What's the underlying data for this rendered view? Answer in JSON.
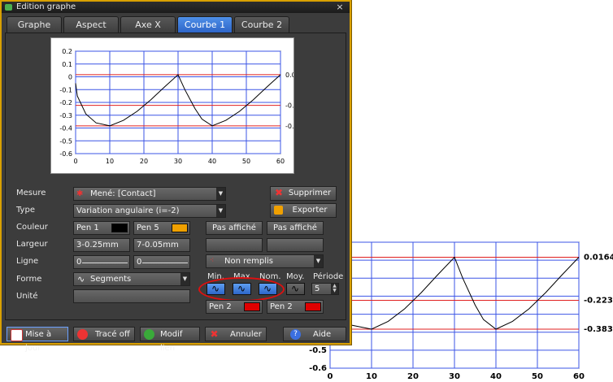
{
  "window": {
    "title": "Edition graphe",
    "close_label": "×"
  },
  "tabs": [
    {
      "label": "Graphe"
    },
    {
      "label": "Aspect"
    },
    {
      "label": "Axe X"
    },
    {
      "label": "Courbe 1",
      "active": true
    },
    {
      "label": "Courbe 2"
    }
  ],
  "chart_data": [
    {
      "type": "line",
      "x": [
        0,
        0.5,
        3,
        6,
        10,
        14,
        18,
        22,
        26,
        30,
        32,
        35,
        37,
        40,
        44,
        48,
        52,
        56,
        60
      ],
      "y": [
        -0.05,
        -0.15,
        -0.29,
        -0.36,
        -0.383,
        -0.34,
        -0.27,
        -0.18,
        -0.08,
        0.0164,
        -0.1,
        -0.25,
        -0.33,
        -0.383,
        -0.34,
        -0.27,
        -0.18,
        -0.08,
        0.0164
      ],
      "xlim": [
        0,
        60
      ],
      "ylim": [
        -0.6,
        0.2
      ],
      "xticks": [
        "0",
        "10",
        "20",
        "30",
        "40",
        "50",
        "60"
      ],
      "yticks": [
        "0.2",
        "0.1",
        "0",
        "-0.1",
        "-0.2",
        "-0.3",
        "-0.4",
        "-0.5",
        "-0.6"
      ],
      "hlines": [
        0.0164,
        -0.223,
        -0.383
      ],
      "hline_labels": [
        "0.0164",
        "-0.223",
        "-0.383"
      ],
      "grid": true,
      "line_color": "#000000",
      "grid_color": "#3b55e6",
      "hline_color": "#e02020"
    },
    {
      "type": "line",
      "x": [
        0,
        2,
        5,
        10,
        14,
        18,
        22,
        26,
        30,
        32,
        35,
        37,
        40,
        44,
        48,
        52,
        56,
        60
      ],
      "y": [
        -0.2,
        -0.3,
        -0.36,
        -0.383,
        -0.34,
        -0.27,
        -0.18,
        -0.08,
        0.0164,
        -0.1,
        -0.25,
        -0.33,
        -0.383,
        -0.34,
        -0.27,
        -0.18,
        -0.08,
        0.0164
      ],
      "xlim": [
        0,
        60
      ],
      "ylim": [
        -0.6,
        0.1
      ],
      "xticks": [
        "0",
        "10",
        "20",
        "30",
        "40",
        "50",
        "60"
      ],
      "yticks": [
        "-0.5",
        "-0.6"
      ],
      "hlines": [
        0.0164,
        -0.223,
        -0.383
      ],
      "hline_labels": [
        "0.0164",
        "-0.223",
        "-0.383"
      ],
      "grid": true,
      "line_color": "#000000",
      "grid_color": "#3b55e6",
      "hline_color": "#e02020"
    }
  ],
  "form": {
    "mesure": {
      "label": "Mesure",
      "value": "Mené: [Contact]"
    },
    "type": {
      "label": "Type",
      "value": "Variation angulaire (i=-2)"
    },
    "couleur": {
      "label": "Couleur",
      "pen1": "Pen 1",
      "pen1_color": "#000000",
      "pen5": "Pen 5",
      "pen5_color": "#f0a000",
      "pas1": "Pas affiché",
      "pas2": "Pas affiché"
    },
    "largeur": {
      "label": "Largeur",
      "v1": "3-0.25mm",
      "v2": "7-0.05mm"
    },
    "ligne": {
      "label": "Ligne",
      "v1": "0",
      "v2": "0",
      "remplis": "Non remplis"
    },
    "forme": {
      "label": "Forme",
      "value": "Segments"
    },
    "unite": {
      "label": "Unité",
      "value": ""
    },
    "stats": {
      "min": "Min.",
      "max": "Max.",
      "nom": "Nom.",
      "moy": "Moy.",
      "periode": "Période",
      "periode_value": "5"
    },
    "pen2a": "Pen 2",
    "pen2b": "Pen 2",
    "pen2_color": "#e00000"
  },
  "side_buttons": {
    "supprimer": "Supprimer",
    "exporter": "Exporter"
  },
  "bottom_buttons": {
    "mise_a_jour": "Mise à jour",
    "trace_off": "Tracé off",
    "modif_lien": "Modif lien",
    "annuler": "Annuler",
    "aide": "Aide"
  }
}
